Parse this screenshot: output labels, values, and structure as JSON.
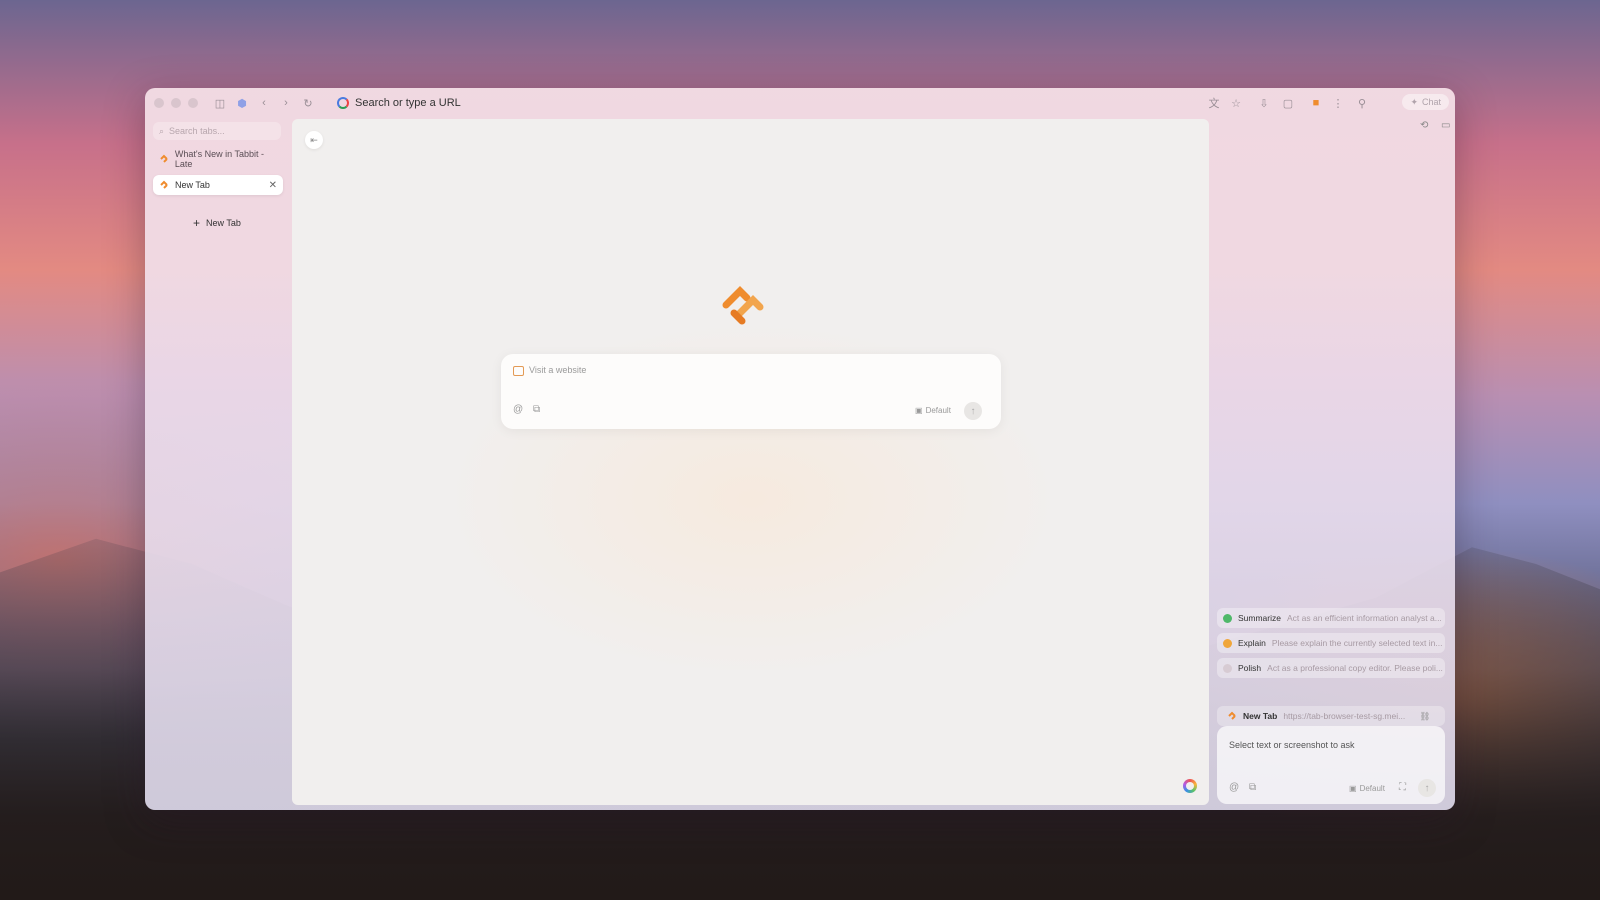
{
  "browser": {
    "url_placeholder": "Search or type a URL",
    "chat_button": "Chat"
  },
  "sidebar": {
    "search_placeholder": "Search tabs...",
    "tabs": [
      {
        "label": "What's New in Tabbit - Late",
        "active": false
      },
      {
        "label": "New Tab",
        "active": true
      }
    ],
    "new_tab_label": "New Tab"
  },
  "main": {
    "input_placeholder": "Visit a website",
    "model_label": "Default"
  },
  "assistant": {
    "prompts": [
      {
        "title": "Summarize",
        "desc": "Act as an efficient information analyst a...",
        "icon_color": "#4fb86a"
      },
      {
        "title": "Explain",
        "desc": "Please explain the currently selected text in...",
        "icon_color": "#f0a63a"
      },
      {
        "title": "Polish",
        "desc": "Act as a professional copy editor. Please poli...",
        "icon_color": "#d7cbd3"
      }
    ],
    "context": {
      "title": "New Tab",
      "url": "https://tab-browser-test-sg.mei..."
    },
    "ask_placeholder": "Select text or screenshot to ask",
    "model_label": "Default"
  },
  "colors": {
    "brand_orange": "#ef8c2e"
  }
}
